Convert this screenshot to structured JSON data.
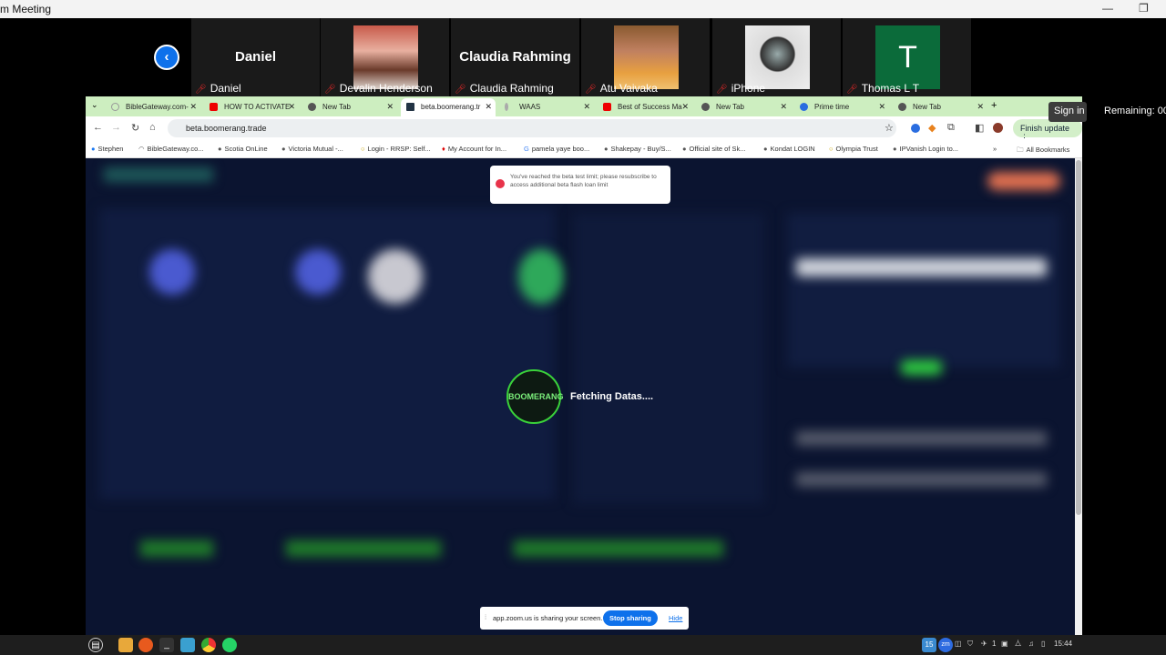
{
  "window": {
    "title": "m Meeting"
  },
  "gallery": {
    "prev_icon": "chevron-left-icon",
    "participants": [
      {
        "name": "Daniel",
        "display": "Daniel",
        "video": false
      },
      {
        "name": "Devalin Henderson",
        "video": true
      },
      {
        "name": "Claudia Rahming",
        "display": "Claudia Rahming",
        "video": false
      },
      {
        "name": "Atu Vaivaka",
        "video": true
      },
      {
        "name": "iPhone",
        "video": true
      },
      {
        "name": "Thomas L T",
        "display": "T",
        "video": false
      }
    ]
  },
  "browser": {
    "tabs": [
      {
        "label": "BibleGateway.com-"
      },
      {
        "label": "HOW TO ACTIVATE"
      },
      {
        "label": "New Tab"
      },
      {
        "label": "beta.boomerang.tr",
        "active": true
      },
      {
        "label": "WAAS"
      },
      {
        "label": "Best of Success Ma"
      },
      {
        "label": "New Tab"
      },
      {
        "label": "Prime time"
      },
      {
        "label": "New Tab"
      }
    ],
    "url": "beta.boomerang.trade",
    "finish_update": "Finish update",
    "bookmarks": [
      "Stephen",
      "BibleGateway.co...",
      "Scotia OnLine",
      "Victoria Mutual -...",
      "Login - RRSP: Self...",
      "My Account for In...",
      "pamela yaye boo...",
      "Shakepay - Buy/S...",
      "Official site of Sk...",
      "Kondat LOGIN",
      "Olympia Trust",
      "IPVanish Login to..."
    ],
    "all_bookmarks": "All Bookmarks"
  },
  "page": {
    "toast": "You've reached the beta test limit; please resubscribe to access additional beta flash loan limit",
    "loader_logo": "BOOMERANG",
    "loading_text": "Fetching Datas...."
  },
  "zoom": {
    "sign_in": "Sign in",
    "remaining": "Remaining: 00:",
    "share_text": "app.zoom.us is sharing your screen.",
    "stop_sharing": "Stop sharing",
    "hide": "Hide"
  },
  "taskbar": {
    "calendar_day": "15",
    "notif_count": "1",
    "time": "15:44"
  }
}
